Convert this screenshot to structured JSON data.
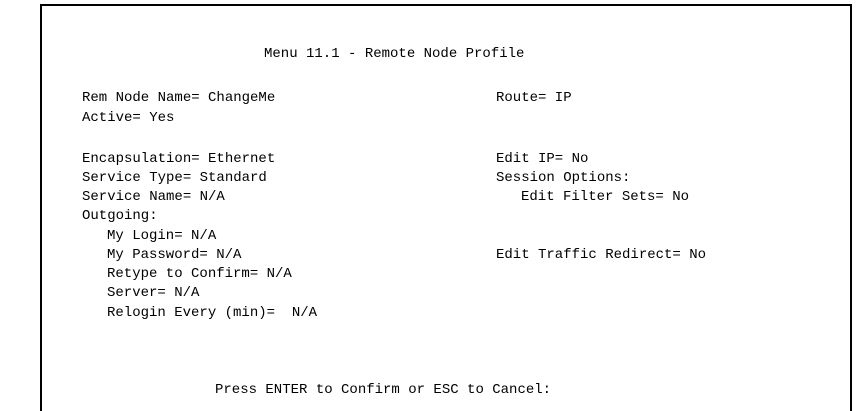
{
  "screen": {
    "title": "Menu 11.1 - Remote Node Profile",
    "left": {
      "rem_node_name": "Rem Node Name= ChangeMe",
      "active": "Active= Yes",
      "encapsulation": "Encapsulation= Ethernet",
      "service_type": "Service Type= Standard",
      "service_name": "Service Name= N/A",
      "outgoing": "Outgoing:",
      "my_login": "My Login= N/A",
      "my_password": "My Password= N/A",
      "retype_confirm": "Retype to Confirm= N/A",
      "server": "Server= N/A",
      "relogin_every": "Relogin Every (min)=  N/A"
    },
    "right": {
      "route": "Route= IP",
      "edit_ip": "Edit IP= No",
      "session_options": "Session Options:",
      "edit_filter_sets": "Edit Filter Sets= No",
      "edit_traffic_redirect": "Edit Traffic Redirect= No"
    },
    "footer": "Press ENTER to Confirm or ESC to Cancel:"
  }
}
